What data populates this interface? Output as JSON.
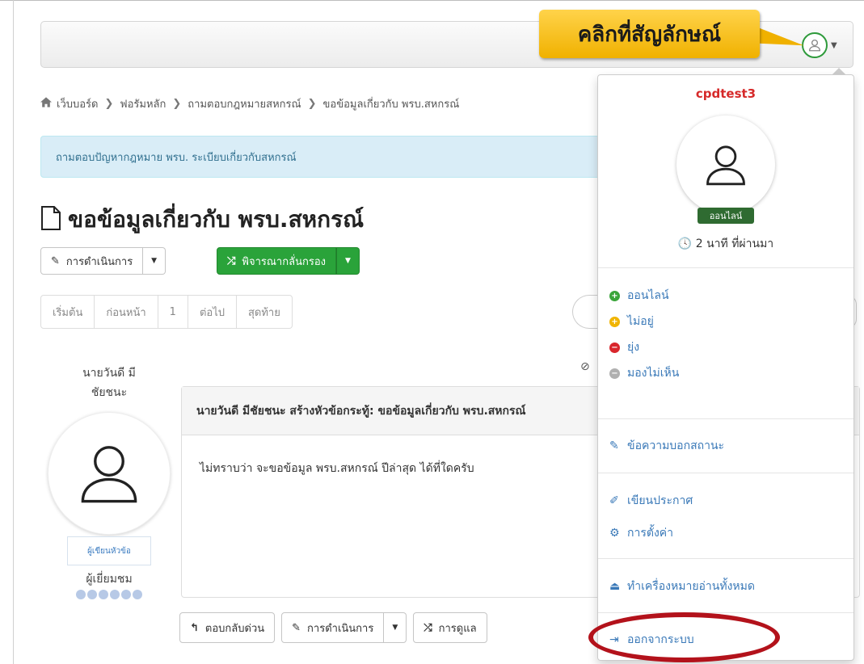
{
  "callout": {
    "text": "คลิกที่สัญลักษณ์"
  },
  "breadcrumb": [
    "เว็บบอร์ด",
    "ฟอรัมหลัก",
    "ถามตอบกฎหมายสหกรณ์",
    "ขอข้อมูลเกี่ยวกับ พรบ.สหกรณ์"
  ],
  "info_bar": {
    "text": "ถามตอบปัญหากฎหมาย พรบ. ระเบียบเกี่ยวกับสหกรณ์"
  },
  "topic": {
    "title": "ขอข้อมูลเกี่ยวกับ พรบ.สหกรณ์"
  },
  "toolbar": {
    "actions_label": "การดำเนินการ",
    "moderation_label": "พิจารณากลั่นกรอง"
  },
  "pager": [
    "เริ่มต้น",
    "ก่อนหน้า",
    "1",
    "ต่อไป",
    "สุดท้าย"
  ],
  "post": {
    "author_name_line1": "นายวันดี มี",
    "author_name_line2": "ชัยชนะ",
    "author_badge": "ผู้เขียนหัวข้อ",
    "author_role": "ผู้เยี่ยมชม",
    "header": "นายวันดี มีชัยชนะ สร้างหัวข้อกระทู้: ขอข้อมูลเกี่ยวกับ พรบ.สหกรณ์",
    "body": "ไม่ทราบว่า จะขอข้อมูล พรบ.สหกรณ์ ปีล่าสุด ได้ที่ใดครับ",
    "quick_reply": "ตอบกลับด่วน",
    "actions": "การดำเนินการ",
    "moderation": "การดูแล"
  },
  "user_menu": {
    "username": "cpdtest3",
    "online_badge": "ออนไลน์",
    "last_active": "2 นาที ที่ผ่านมา",
    "status_online": "ออนไลน์",
    "status_away": "ไม่อยู่",
    "status_busy": "ยุ่ง",
    "status_invisible": "มองไม่เห็น",
    "status_message": "ข้อความบอกสถานะ",
    "write_announcement": "เขียนประกาศ",
    "settings": "การตั้งค่า",
    "mark_all_read": "ทำเครื่องหมายอ่านทั้งหมด",
    "logout": "ออกจากระบบ"
  },
  "colors": {
    "online": "#3aa53a",
    "away": "#f0b400",
    "busy": "#d9262c",
    "invisible": "#b0b0b0",
    "highlight_ring": "#b3121b",
    "callout": "#f5c020"
  }
}
